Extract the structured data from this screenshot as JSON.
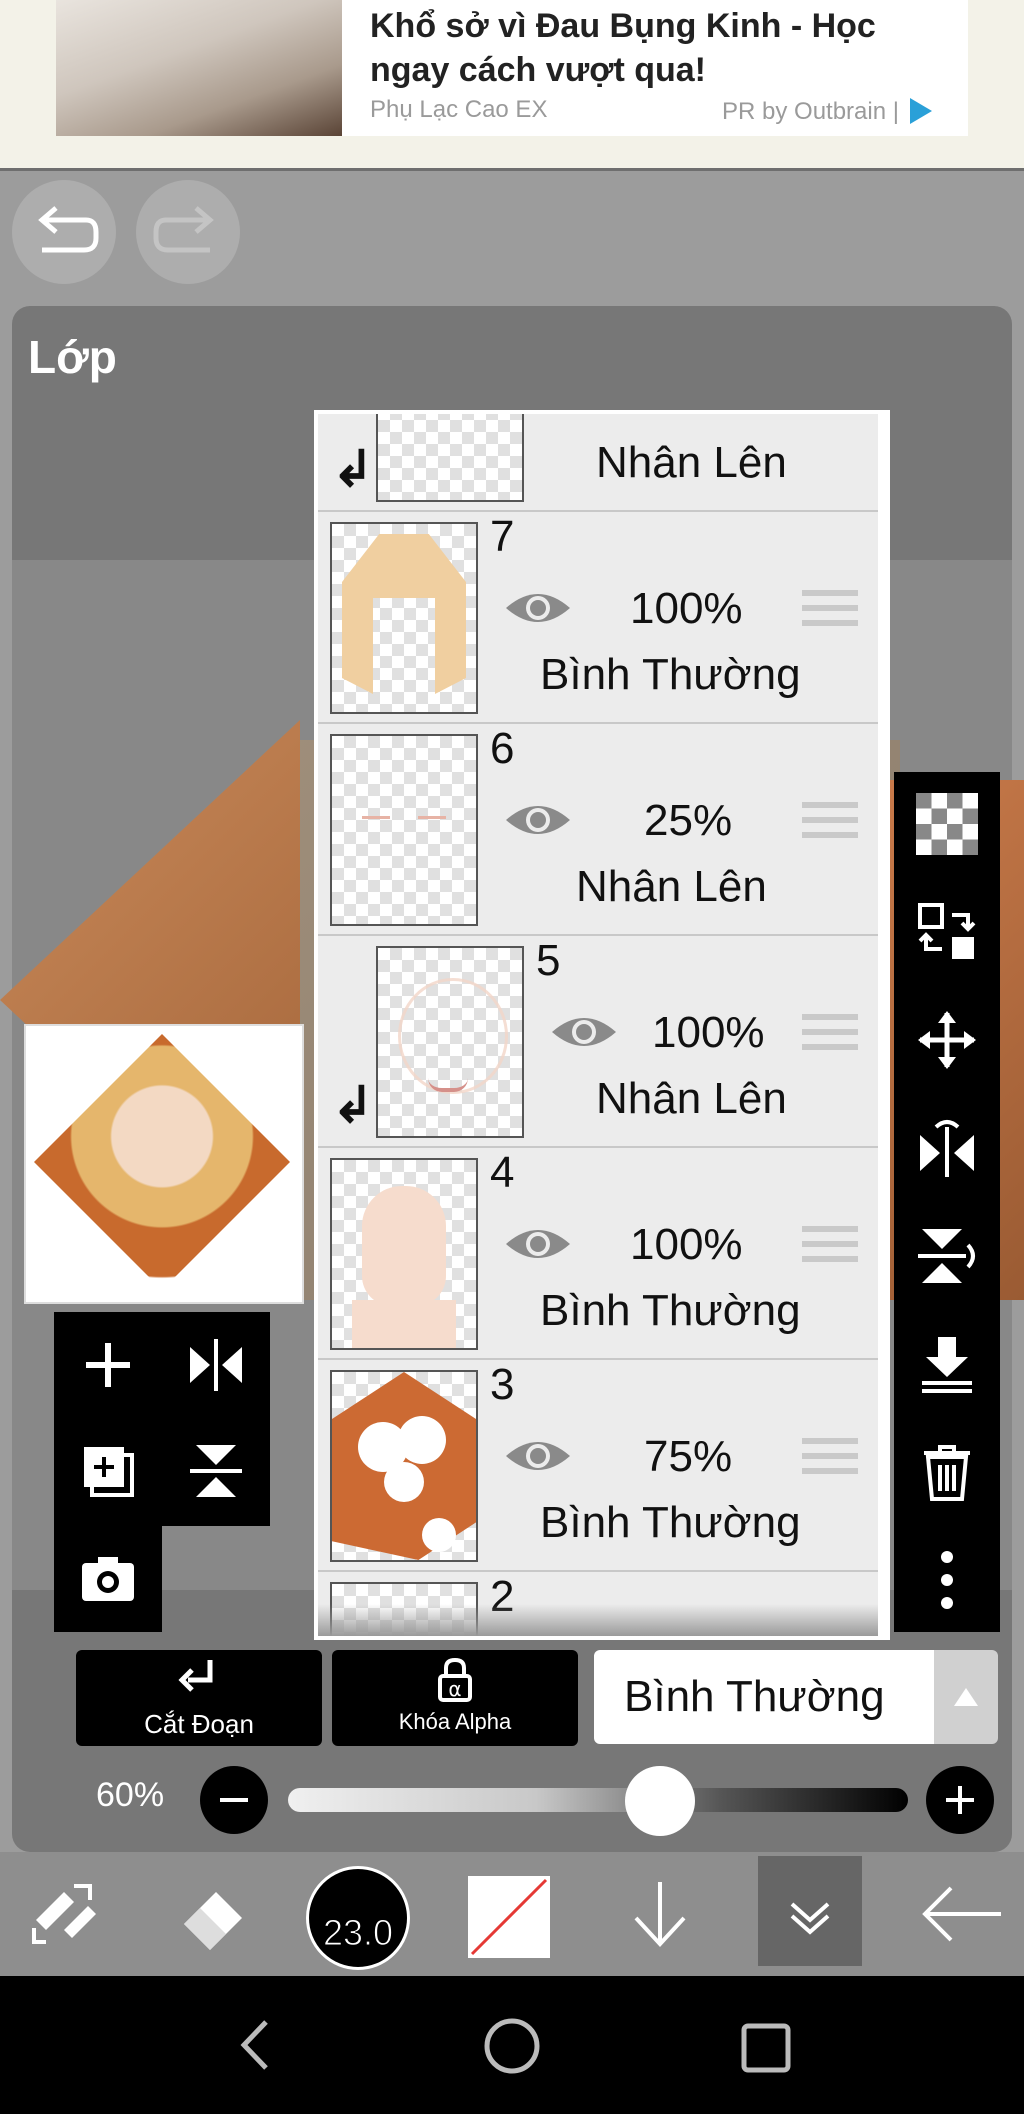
{
  "ad": {
    "title": "Khổ sở vì Đau Bụng Kinh - Học ngay cách vượt qua!",
    "source": "Phụ Lạc Cao EX",
    "pr_label": "PR by Outbrain |"
  },
  "panel": {
    "title": "Lớp"
  },
  "layers": [
    {
      "number": "",
      "opacity": "",
      "mode": "Nhân Lên",
      "clipped": true
    },
    {
      "number": "7",
      "opacity": "100%",
      "mode": "Bình Thường",
      "clipped": false
    },
    {
      "number": "6",
      "opacity": "25%",
      "mode": "Nhân Lên",
      "clipped": false
    },
    {
      "number": "5",
      "opacity": "100%",
      "mode": "Nhân Lên",
      "clipped": true
    },
    {
      "number": "4",
      "opacity": "100%",
      "mode": "Bình Thường",
      "clipped": false
    },
    {
      "number": "3",
      "opacity": "75%",
      "mode": "Bình Thường",
      "clipped": false
    },
    {
      "number": "2",
      "opacity": "",
      "mode": "",
      "clipped": false
    }
  ],
  "layer_controls": {
    "clip_label": "Cắt Đoạn",
    "alpha_lock_label": "Khóa Alpha",
    "blend_mode": "Bình Thường",
    "opacity": "60%",
    "opacity_value": 0.6
  },
  "toolbar": {
    "brush_size": "23.0"
  },
  "icons": {
    "undo": "undo-icon",
    "redo": "redo-icon",
    "eye": "eye-icon"
  }
}
